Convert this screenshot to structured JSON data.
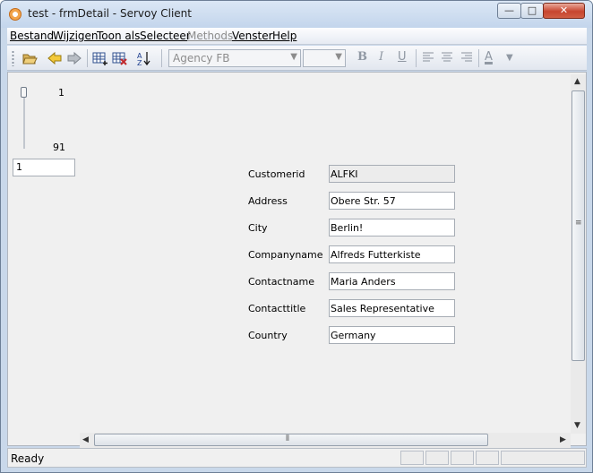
{
  "window": {
    "title": "test - frmDetail - Servoy Client",
    "minimize_glyph": "—",
    "maximize_glyph": "□",
    "close_glyph": "✕"
  },
  "menu": [
    {
      "label": "Bestand"
    },
    {
      "label": "Wijzigen"
    },
    {
      "label": "Toon als"
    },
    {
      "label": "Selecteer"
    },
    {
      "label": "Methods",
      "disabled": true
    },
    {
      "label": "Venster"
    },
    {
      "label": "Help"
    }
  ],
  "toolbar": {
    "icons": [
      "open-folder-icon",
      "back-arrow-icon",
      "forward-arrow-icon",
      "new-record-icon",
      "delete-record-icon",
      "sort-icon"
    ],
    "font_combo": "Agency FB",
    "size_combo": "",
    "format_buttons": {
      "bold": "B",
      "italic": "I",
      "underline": "U"
    },
    "text_color": "A"
  },
  "navigator": {
    "max": "1",
    "min": "91",
    "record": "1"
  },
  "fields": [
    {
      "label": "Customerid",
      "value": "ALFKI",
      "readonly": true
    },
    {
      "label": "Address",
      "value": "Obere Str. 57"
    },
    {
      "label": "City",
      "value": "Berlin!"
    },
    {
      "label": "Companyname",
      "value": "Alfreds Futterkiste"
    },
    {
      "label": "Contactname",
      "value": "Maria Anders"
    },
    {
      "label": "Contacttitle",
      "value": "Sales Representative"
    },
    {
      "label": "Country",
      "value": "Germany"
    }
  ],
  "status": {
    "text": "Ready"
  },
  "colors": {
    "titlebar": "#c9d8ea",
    "close": "#c7452f",
    "content_bg": "#f0f0f0"
  }
}
